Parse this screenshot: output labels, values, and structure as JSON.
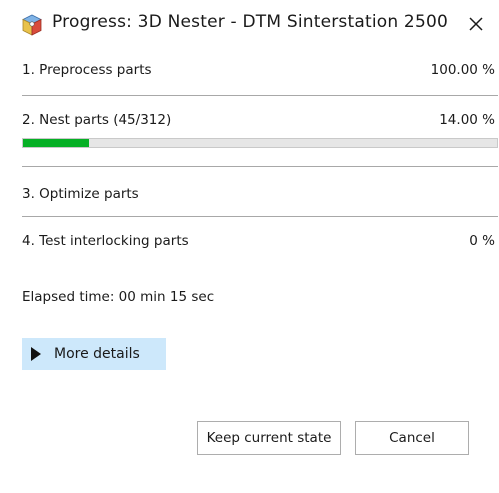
{
  "window": {
    "title": "Progress: 3D Nester - DTM Sinterstation 2500 ...",
    "icon": "cube-gear-icon",
    "close_glyph": "✕"
  },
  "steps": [
    {
      "label": "1. Preprocess parts",
      "percent_text": "100.00  %",
      "percent": 100
    },
    {
      "label": "2. Nest parts  (45/312)",
      "percent_text": "14.00  %",
      "percent": 14
    },
    {
      "label": "3. Optimize parts",
      "percent_text": ""
    },
    {
      "label": "4. Test interlocking parts",
      "percent_text": "0  %",
      "percent": 0
    }
  ],
  "progress": {
    "value_fraction": 0.14,
    "color": "#06b025"
  },
  "elapsed": {
    "text": "Elapsed time:  00 min 15 sec"
  },
  "details": {
    "label": "More details",
    "icon": "expand-triangle-icon",
    "highlight_color": "#cde8fb"
  },
  "buttons": {
    "keep_label": "Keep current state",
    "cancel_label": "Cancel"
  }
}
